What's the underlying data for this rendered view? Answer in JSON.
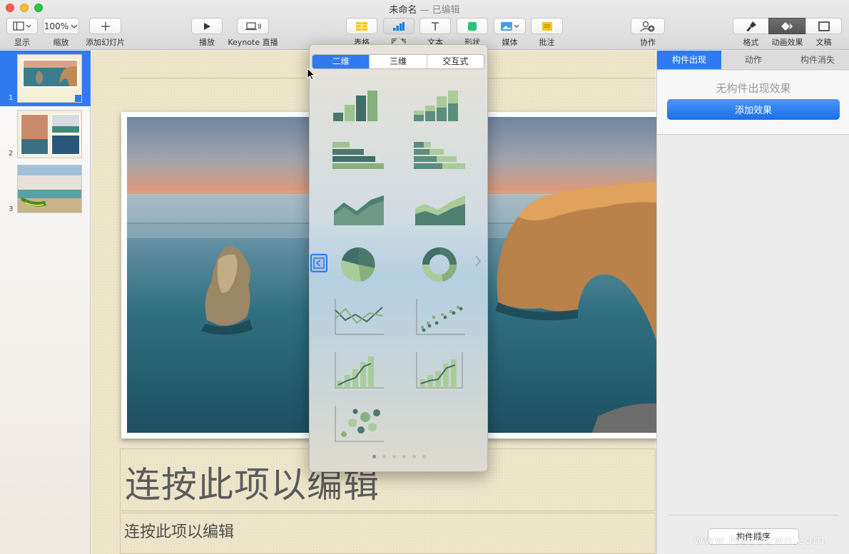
{
  "window": {
    "title": "未命名",
    "subtitle": " — 已编辑"
  },
  "toolbar": {
    "view_label": "显示",
    "zoom_value": "100%",
    "zoom_label": "缩放",
    "add_slide_label": "添加幻灯片",
    "play_label": "播放",
    "keynote_live_label": "Keynote 直播",
    "table_label": "表格",
    "chart_label": "图表",
    "text_label": "文本",
    "shape_label": "形状",
    "media_label": "媒体",
    "comment_label": "批注",
    "collaborate_label": "协作",
    "format_label": "格式",
    "animate_label": "动画效果",
    "document_label": "文稿"
  },
  "navigator": {
    "slides": [
      {
        "number": "1"
      },
      {
        "number": "2"
      },
      {
        "number": "3"
      }
    ]
  },
  "slide": {
    "title_placeholder": "连按此项以编辑",
    "body_placeholder": "连按此项以编辑"
  },
  "inspector": {
    "tabs": [
      "构件出现",
      "动作",
      "构件消失"
    ],
    "no_effect_text": "无构件出现效果",
    "add_effect_label": "添加效果",
    "build_order_label": "构件顺序"
  },
  "chart_popover": {
    "tabs": [
      "二维",
      "三维",
      "交互式"
    ],
    "active_tab": "二维",
    "chart_types": [
      "column-chart",
      "stacked-column-chart",
      "bar-chart",
      "stacked-bar-chart",
      "area-chart",
      "stacked-area-chart",
      "pie-chart",
      "donut-chart",
      "line-chart",
      "scatter-chart",
      "mixed-chart",
      "two-axis-chart",
      "bubble-chart"
    ],
    "page_count": 6,
    "current_page": 1
  },
  "watermark": "www.MacDown.com",
  "colors": {
    "accent": "#2f7bef",
    "chart_dark": "#3f6f68",
    "chart_mid": "#7fa48a",
    "chart_light": "#a9cc9a"
  }
}
